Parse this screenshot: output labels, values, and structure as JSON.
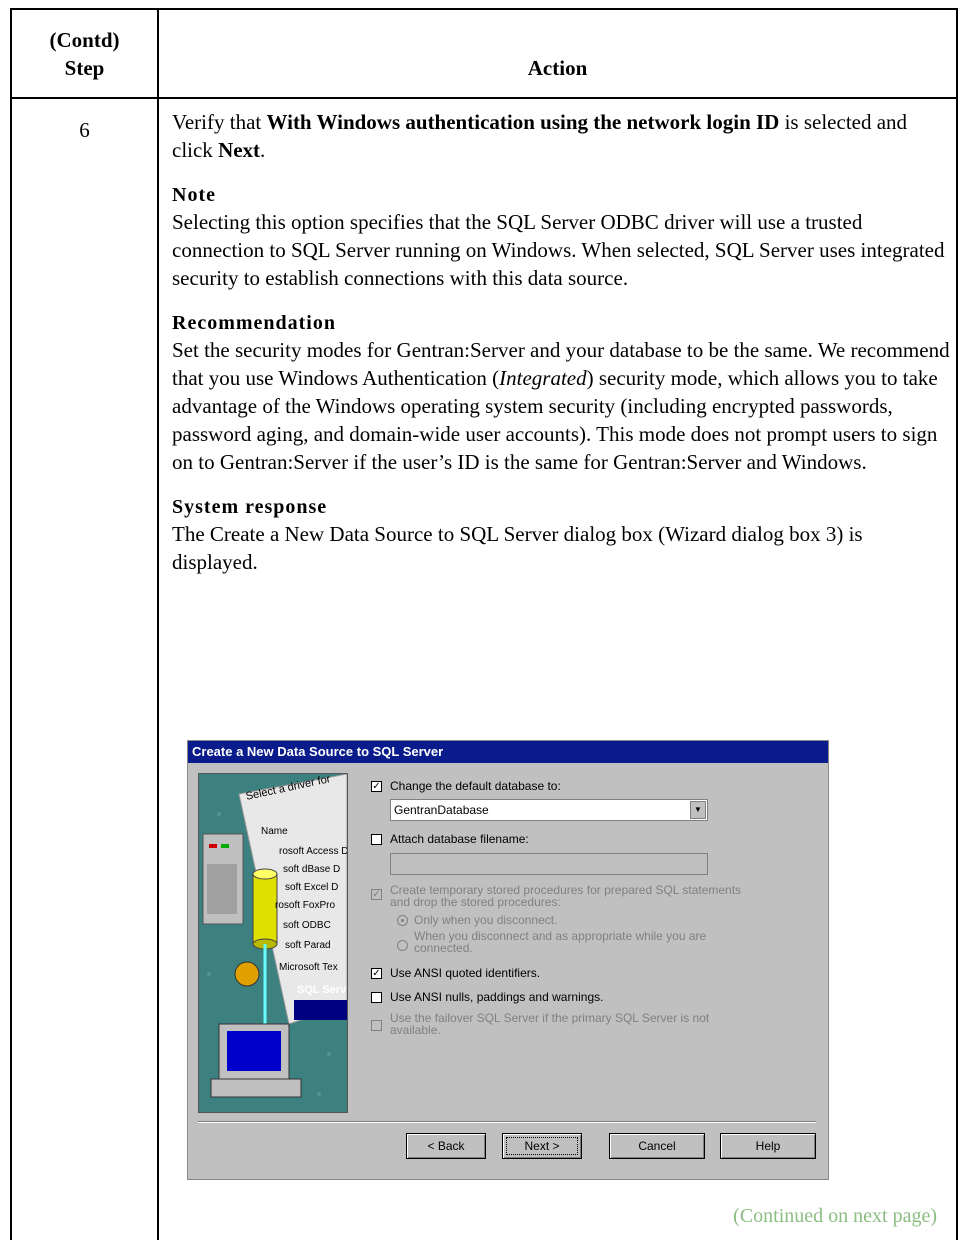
{
  "header": {
    "step_line1": "(Contd)",
    "step_line2": "Step",
    "action": "Action"
  },
  "step": {
    "number": "6",
    "intro_part1": "Verify that ",
    "intro_bold": "With Windows authentication using the network login ID",
    "intro_part2": " is selected and click ",
    "intro_next": "Next",
    "intro_end": "."
  },
  "note": {
    "heading": "Note",
    "text": "Selecting this option specifies that the SQL Server ODBC driver will use a trusted connection to SQL Server running on Windows. When selected, SQL Server uses integrated security to establish connections with this data source."
  },
  "recommendation": {
    "heading": "Recommendation",
    "text_a": "Set the security modes for Gentran:Server and your database to be the same. We recommend that you use Windows Authentication (",
    "text_italic": "Integrated",
    "text_b": ") security mode, which allows you to take advantage of the Windows operating system security (including encrypted passwords, password aging, and domain-wide user accounts). This mode does not prompt users to sign on to Gentran:Server if the user’s ID is the same for Gentran:Server and Windows."
  },
  "system_response": {
    "heading": "System response",
    "text": "The Create a New Data Source to SQL Server dialog box (Wizard dialog box 3) is displayed."
  },
  "dialog": {
    "title": "Create a New Data Source to SQL Server",
    "art_lines": [
      "Select a driver for",
      "Name",
      "rosoft Access D",
      "soft dBase D",
      "soft Excel D",
      "rosoft FoxPro",
      "soft ODBC",
      "soft Parad",
      "Microsoft Tex",
      "SQL Serv"
    ],
    "change_db_label": "Change the default database to:",
    "change_db_value": "GentranDatabase",
    "attach_label": "Attach database filename:",
    "attach_value": "",
    "temp_proc_line1": "Create temporary stored procedures for prepared SQL statements",
    "temp_proc_line2": "and drop the stored procedures:",
    "radio_only": "Only when you disconnect.",
    "radio_when_line1": "When you disconnect and as appropriate while you are",
    "radio_when_line2": "connected.",
    "ansi_quoted": "Use ANSI quoted identifiers.",
    "ansi_nulls": "Use ANSI nulls, paddings and warnings.",
    "failover_line1": "Use the failover SQL Server if the primary SQL Server is not",
    "failover_line2": "available.",
    "btn_back": "< Back",
    "btn_next": "Next >",
    "btn_cancel": "Cancel",
    "btn_help": "Help",
    "check_mark": "✓",
    "dd_arrow": "▼"
  },
  "continued": "(Continued on next page)"
}
